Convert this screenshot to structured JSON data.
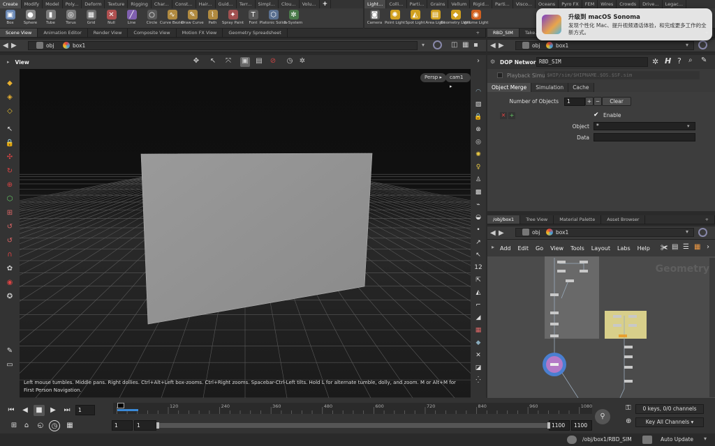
{
  "shelf_left_tabs": [
    "Create",
    "Modify",
    "Model",
    "Poly...",
    "Deform",
    "Texture",
    "Rigging",
    "Char...",
    "Const...",
    "Hair...",
    "Guid...",
    "Terr...",
    "Simpl...",
    "Clou...",
    "Volu..."
  ],
  "shelf_left_tools": [
    {
      "label": "Box",
      "icon": "box-icon",
      "color": "#6a88b5"
    },
    {
      "label": "Sphere",
      "icon": "sphere-icon",
      "color": "#8a8a8a"
    },
    {
      "label": "Tube",
      "icon": "tube-icon",
      "color": "#7a7a7a"
    },
    {
      "label": "Torus",
      "icon": "torus-icon",
      "color": "#7a7a7a"
    },
    {
      "label": "Grid",
      "icon": "grid-icon",
      "color": "#6a6a6a"
    },
    {
      "label": "Null",
      "icon": "null-icon",
      "color": "#b05050"
    },
    {
      "label": "Line",
      "icon": "line-icon",
      "color": "#8060b0"
    },
    {
      "label": "Circle",
      "icon": "circle-icon",
      "color": "#5a5a5a"
    },
    {
      "label": "Curve Bezier",
      "icon": "curve-bezier-icon",
      "color": "#b08a40"
    },
    {
      "label": "Draw Curve",
      "icon": "draw-curve-icon",
      "color": "#b08a40"
    },
    {
      "label": "Path",
      "icon": "path-icon",
      "color": "#b08a40"
    },
    {
      "label": "Spray Paint",
      "icon": "spray-paint-icon",
      "color": "#a05050"
    },
    {
      "label": "Font",
      "icon": "font-icon",
      "color": "#5a5a5a"
    },
    {
      "label": "Platonic Solids",
      "icon": "platonic-solids-icon",
      "color": "#5a7090"
    },
    {
      "label": "L-System",
      "icon": "l-system-icon",
      "color": "#4a7a4a"
    }
  ],
  "shelf_right_tabs": [
    "Light...",
    "Colli...",
    "Parti...",
    "Grains",
    "Vellum",
    "Rigid...",
    "Parti...",
    "Visco...",
    "Oceans",
    "Pyro FX",
    "FEM",
    "Wires",
    "Crowds",
    "Drive...",
    "Legac..."
  ],
  "shelf_right_tools": [
    {
      "label": "Camera",
      "icon": "camera-icon",
      "color": "#5a5a5a"
    },
    {
      "label": "Point Light",
      "icon": "point-light-icon",
      "color": "#d0a020"
    },
    {
      "label": "Spot Light",
      "icon": "spot-light-icon",
      "color": "#d0a020"
    },
    {
      "label": "Area Light",
      "icon": "area-light-icon",
      "color": "#d0a020"
    },
    {
      "label": "Geometry Light",
      "icon": "geometry-light-icon",
      "color": "#d0a020"
    },
    {
      "label": "Volume Light",
      "icon": "volume-light-icon",
      "color": "#d06020"
    }
  ],
  "notification": {
    "title": "升级到 macOS Sonoma",
    "body": "发现个性化 Mac、提升视频通话体验，和完成更多工作的全新方式。"
  },
  "left_pane_tabs": [
    "Scene View",
    "Animation Editor",
    "Render View",
    "Composite View",
    "Motion FX View",
    "Geometry Spreadsheet"
  ],
  "right_pane_tabs": [
    "RBD_SIM",
    "Take..."
  ],
  "left_path": {
    "obj": "obj",
    "node": "box1"
  },
  "viewport": {
    "title": "View",
    "persp_label": "Persp",
    "cam_label": "cam1",
    "hint": "Left mouse tumbles. Middle pans. Right dollies. Ctrl+Alt+Left box-zooms. Ctrl+Right zooms. Spacebar-Ctrl-Left tilts. Hold L for alternate tumble, dolly, and zoom.    M or Alt+M for First Person Navigation."
  },
  "param_path": {
    "obj": "obj",
    "node": "box1"
  },
  "params": {
    "node_type": "DOP Network",
    "node_name": "RBD_SIM",
    "playback_label": "Playback Simulation",
    "playback_path": "$HIP/sim/$HIPNAME.$OS.$SF.sim",
    "tabs": [
      "Object Merge",
      "Simulation",
      "Cache"
    ],
    "num_objects_label": "Number of Objects",
    "num_objects_value": "1",
    "clear_label": "Clear",
    "enable_label": "Enable",
    "object_label": "Object",
    "object_value": "*",
    "data_label": "Data",
    "data_value": ""
  },
  "net_pane_tabs": [
    "/obj/box1",
    "Tree View",
    "Material Palette",
    "Asset Browser"
  ],
  "net_path": {
    "obj": "obj",
    "node": "box1"
  },
  "net_menu": [
    "Add",
    "Edit",
    "Go",
    "View",
    "Tools",
    "Layout",
    "Labs",
    "Help"
  ],
  "network_label": "Geometry",
  "timeline": {
    "ticks": [
      "1",
      "120",
      "240",
      "360",
      "480",
      "600",
      "720",
      "840",
      "960",
      "1080"
    ],
    "current_frame": "1",
    "range_start": "1",
    "range_start2": "1",
    "range_end": "1100",
    "range_end2": "1100",
    "keys_label": "0 keys, 0/0 channels",
    "key_channels_label": "Key All Channels"
  },
  "status": {
    "path": "/obj/box1/RBD_SIM",
    "update_mode": "Auto Update"
  }
}
